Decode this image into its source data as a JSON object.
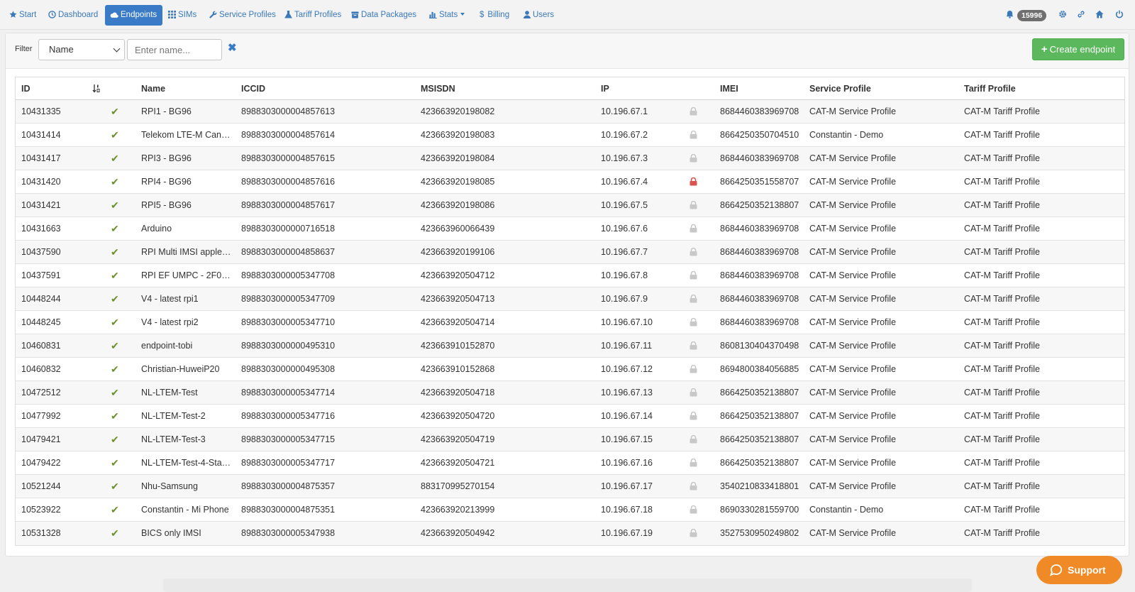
{
  "nav": {
    "items": [
      {
        "label": "Start",
        "icon": "star-icon"
      },
      {
        "label": "Dashboard",
        "icon": "clock-icon"
      },
      {
        "label": "Endpoints",
        "icon": "cloud-icon",
        "active": true
      },
      {
        "label": "SIMs",
        "icon": "grid-icon"
      },
      {
        "label": "Service Profiles",
        "icon": "wrench-icon"
      },
      {
        "label": "Tariff Profiles",
        "icon": "flask-icon"
      },
      {
        "label": "Data Packages",
        "icon": "package-icon"
      },
      {
        "label": "Stats",
        "icon": "bar-chart-icon"
      },
      {
        "label": "Billing",
        "icon": "dollar-icon"
      },
      {
        "label": "Users",
        "icon": "user-icon"
      }
    ],
    "notification_count": "15996"
  },
  "filter": {
    "label": "Filter",
    "field_selected": "Name",
    "input_placeholder": "Enter name...",
    "clear_symbol": "✖",
    "create_label": "Create endpoint"
  },
  "table": {
    "headers": {
      "id": "ID",
      "name": "Name",
      "iccid": "ICCID",
      "msisdn": "MSISDN",
      "ip": "IP",
      "imei": "IMEI",
      "service_profile": "Service Profile",
      "tariff_profile": "Tariff Profile"
    },
    "rows": [
      {
        "id": "10431335",
        "name": "RPI1 - BG96",
        "iccid": "8988303000004857613",
        "msisdn": "423663920198082",
        "ip": "10.196.67.1",
        "locked": false,
        "imei": "8684460383969708",
        "service_profile": "CAT-M Service Profile",
        "tariff_profile": "CAT-M Tariff Profile"
      },
      {
        "id": "10431414",
        "name": "Telekom LTE-M Can…",
        "iccid": "8988303000004857614",
        "msisdn": "423663920198083",
        "ip": "10.196.67.2",
        "locked": false,
        "imei": "8664250350704510",
        "service_profile": "Constantin - Demo",
        "tariff_profile": "CAT-M Tariff Profile"
      },
      {
        "id": "10431417",
        "name": "RPI3 - BG96",
        "iccid": "8988303000004857615",
        "msisdn": "423663920198084",
        "ip": "10.196.67.3",
        "locked": false,
        "imei": "8684460383969708",
        "service_profile": "CAT-M Service Profile",
        "tariff_profile": "CAT-M Tariff Profile"
      },
      {
        "id": "10431420",
        "name": "RPI4 - BG96",
        "iccid": "8988303000004857616",
        "msisdn": "423663920198085",
        "ip": "10.196.67.4",
        "locked": true,
        "imei": "8664250351558707",
        "service_profile": "CAT-M Service Profile",
        "tariff_profile": "CAT-M Tariff Profile"
      },
      {
        "id": "10431421",
        "name": "RPI5 - BG96",
        "iccid": "8988303000004857617",
        "msisdn": "423663920198086",
        "ip": "10.196.67.5",
        "locked": false,
        "imei": "8664250352138807",
        "service_profile": "CAT-M Service Profile",
        "tariff_profile": "CAT-M Tariff Profile"
      },
      {
        "id": "10431663",
        "name": "Arduino",
        "iccid": "8988303000000716518",
        "msisdn": "423663960066439",
        "ip": "10.196.67.6",
        "locked": false,
        "imei": "8684460383969708",
        "service_profile": "CAT-M Service Profile",
        "tariff_profile": "CAT-M Tariff Profile"
      },
      {
        "id": "10437590",
        "name": "RPI Multi IMSI apple…",
        "iccid": "8988303000004858637",
        "msisdn": "423663920199106",
        "ip": "10.196.67.7",
        "locked": false,
        "imei": "8684460383969708",
        "service_profile": "CAT-M Service Profile",
        "tariff_profile": "CAT-M Tariff Profile"
      },
      {
        "id": "10437591",
        "name": "RPI EF UMPC - 2F0…",
        "iccid": "8988303000005347708",
        "msisdn": "423663920504712",
        "ip": "10.196.67.8",
        "locked": false,
        "imei": "8684460383969708",
        "service_profile": "CAT-M Service Profile",
        "tariff_profile": "CAT-M Tariff Profile"
      },
      {
        "id": "10448244",
        "name": "V4 - latest rpi1",
        "iccid": "8988303000005347709",
        "msisdn": "423663920504713",
        "ip": "10.196.67.9",
        "locked": false,
        "imei": "8684460383969708",
        "service_profile": "CAT-M Service Profile",
        "tariff_profile": "CAT-M Tariff Profile"
      },
      {
        "id": "10448245",
        "name": "V4 - latest rpi2",
        "iccid": "8988303000005347710",
        "msisdn": "423663920504714",
        "ip": "10.196.67.10",
        "locked": false,
        "imei": "8684460383969708",
        "service_profile": "CAT-M Service Profile",
        "tariff_profile": "CAT-M Tariff Profile"
      },
      {
        "id": "10460831",
        "name": "endpoint-tobi",
        "iccid": "8988303000000495310",
        "msisdn": "423663910152870",
        "ip": "10.196.67.11",
        "locked": false,
        "imei": "8608130404370498",
        "service_profile": "CAT-M Service Profile",
        "tariff_profile": "CAT-M Tariff Profile"
      },
      {
        "id": "10460832",
        "name": "Christian-HuweiP20",
        "iccid": "8988303000000495308",
        "msisdn": "423663910152868",
        "ip": "10.196.67.12",
        "locked": false,
        "imei": "8694800384056885",
        "service_profile": "CAT-M Service Profile",
        "tariff_profile": "CAT-M Tariff Profile"
      },
      {
        "id": "10472512",
        "name": "NL-LTEM-Test",
        "iccid": "8988303000005347714",
        "msisdn": "423663920504718",
        "ip": "10.196.67.13",
        "locked": false,
        "imei": "8664250352138807",
        "service_profile": "CAT-M Service Profile",
        "tariff_profile": "CAT-M Tariff Profile"
      },
      {
        "id": "10477992",
        "name": "NL-LTEM-Test-2",
        "iccid": "8988303000005347716",
        "msisdn": "423663920504720",
        "ip": "10.196.67.14",
        "locked": false,
        "imei": "8664250352138807",
        "service_profile": "CAT-M Service Profile",
        "tariff_profile": "CAT-M Tariff Profile"
      },
      {
        "id": "10479421",
        "name": "NL-LTEM-Test-3",
        "iccid": "8988303000005347715",
        "msisdn": "423663920504719",
        "ip": "10.196.67.15",
        "locked": false,
        "imei": "8664250352138807",
        "service_profile": "CAT-M Service Profile",
        "tariff_profile": "CAT-M Tariff Profile"
      },
      {
        "id": "10479422",
        "name": "NL-LTEM-Test-4-Sta…",
        "iccid": "8988303000005347717",
        "msisdn": "423663920504721",
        "ip": "10.196.67.16",
        "locked": false,
        "imei": "8664250352138807",
        "service_profile": "CAT-M Service Profile",
        "tariff_profile": "CAT-M Tariff Profile"
      },
      {
        "id": "10521244",
        "name": "Nhu-Samsung",
        "iccid": "8988303000004875357",
        "msisdn": "883170995270154",
        "ip": "10.196.67.17",
        "locked": false,
        "imei": "3540210833418801",
        "service_profile": "CAT-M Service Profile",
        "tariff_profile": "CAT-M Tariff Profile"
      },
      {
        "id": "10523922",
        "name": "Constantin - Mi Phone",
        "iccid": "8988303000004875351",
        "msisdn": "423663920213999",
        "ip": "10.196.67.18",
        "locked": false,
        "imei": "8690330281559700",
        "service_profile": "Constantin - Demo",
        "tariff_profile": "CAT-M Tariff Profile"
      },
      {
        "id": "10531328",
        "name": "BICS only IMSI",
        "iccid": "8988303000005347938",
        "msisdn": "423663920504942",
        "ip": "10.196.67.19",
        "locked": false,
        "imei": "3527530950249802",
        "service_profile": "CAT-M Service Profile",
        "tariff_profile": "CAT-M Tariff Profile"
      }
    ]
  },
  "support": {
    "label": "Support"
  },
  "colors": {
    "accent": "#3a7bc8",
    "success": "#5cb85c",
    "support": "#f08a26",
    "lock_active": "#d9534f",
    "lock_inactive": "#c8c8c8",
    "check": "#6e8f2e"
  }
}
